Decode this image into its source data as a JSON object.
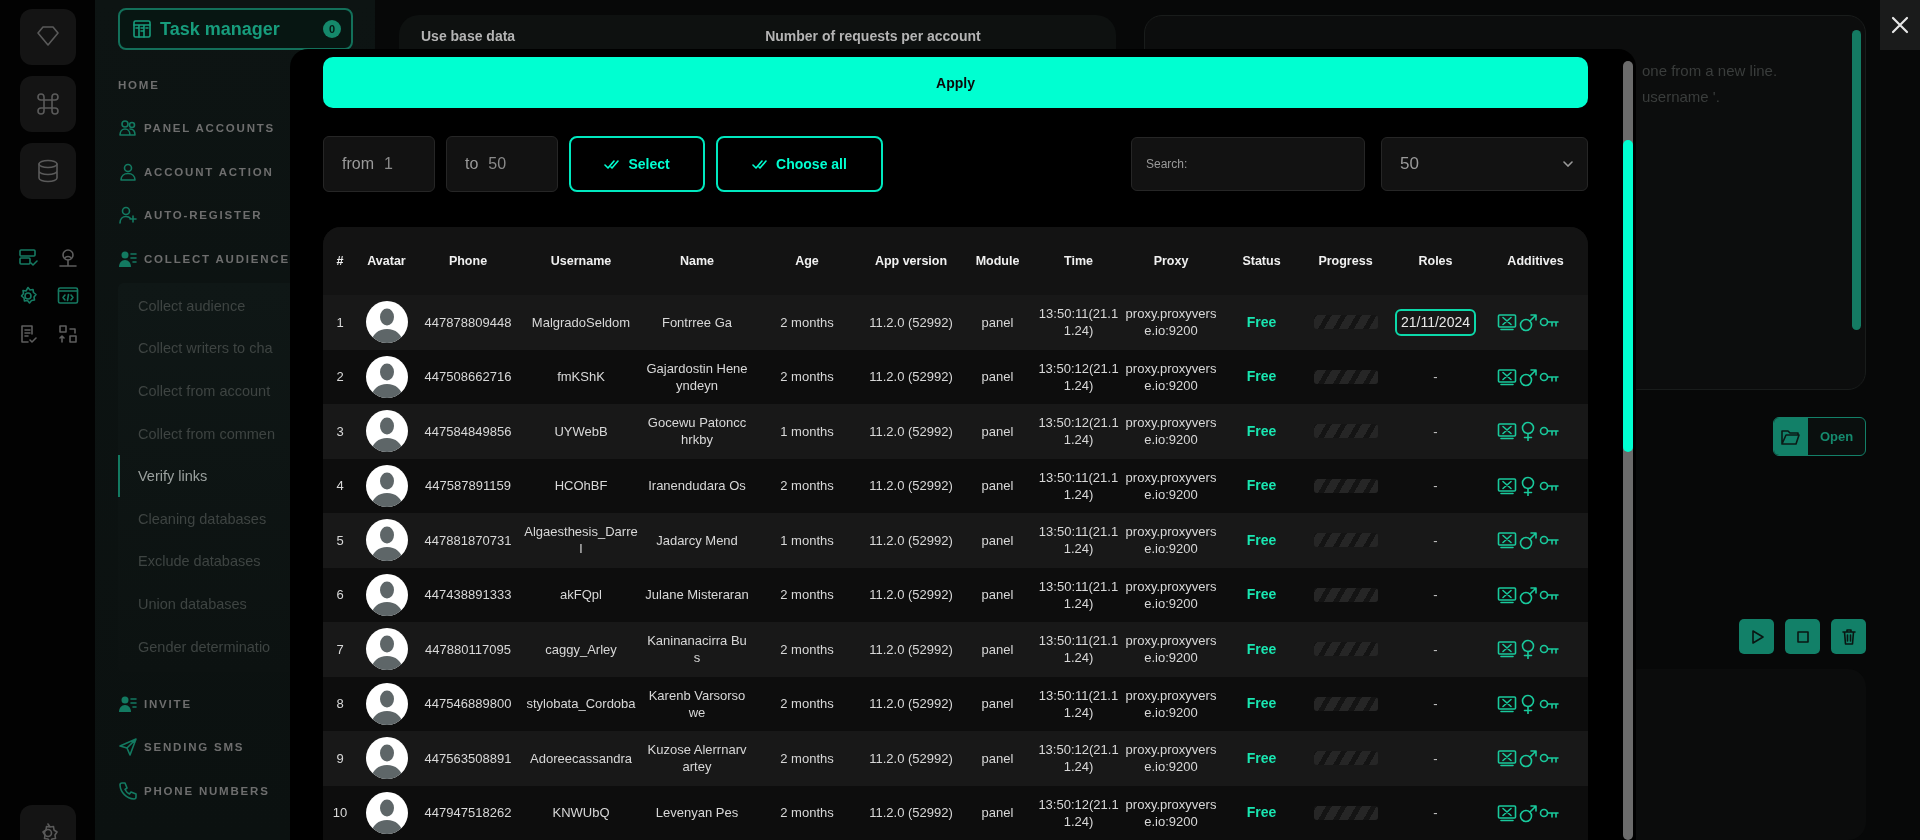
{
  "sidebar": {
    "task_manager": {
      "label": "Task manager",
      "badge": "0"
    },
    "menu": [
      {
        "label": "HOME",
        "kind": "heading"
      },
      {
        "label": "PANEL ACCOUNTS",
        "kind": "section"
      },
      {
        "label": "ACCOUNT ACTION",
        "kind": "section"
      },
      {
        "label": "AUTO-REGISTER",
        "kind": "section"
      },
      {
        "label": "COLLECT AUDIENCE",
        "kind": "section",
        "children": [
          {
            "label": "Collect audience",
            "selected": false
          },
          {
            "label": "Collect writers to cha",
            "selected": false
          },
          {
            "label": "Collect from account",
            "selected": false
          },
          {
            "label": "Collect from commen",
            "selected": false
          },
          {
            "label": "Verify links",
            "selected": true
          },
          {
            "label": "Cleaning databases",
            "selected": false
          },
          {
            "label": "Exclude databases",
            "selected": false
          },
          {
            "label": "Union databases",
            "selected": false
          },
          {
            "label": "Gender determinatio",
            "selected": false
          }
        ]
      },
      {
        "label": "INVITE",
        "kind": "section"
      },
      {
        "label": "SENDING SMS",
        "kind": "section"
      },
      {
        "label": "PHONE NUMBERS",
        "kind": "section"
      }
    ]
  },
  "settings_card": {
    "labels": [
      "Use base data",
      "Number of requests per account"
    ]
  },
  "list_card": {
    "placeholder_lines": [
      "one from a new line.",
      "username '."
    ]
  },
  "open_button": "Open",
  "modal": {
    "apply_button": "Apply",
    "from_field": {
      "label": "from",
      "value": "1"
    },
    "to_field": {
      "label": "to",
      "value": "50"
    },
    "select_button": "Select",
    "choose_all_button": "Choose all",
    "search": {
      "placeholder": "Search:"
    },
    "page_size": "50",
    "table": {
      "columns": [
        "#",
        "Avatar",
        "Phone",
        "Username",
        "Name",
        "Age",
        "App version",
        "Module",
        "Time",
        "Proxy",
        "Status",
        "Progress",
        "Roles",
        "Additives"
      ],
      "rows": [
        {
          "index": "1",
          "phone": "447878809448",
          "username": "MalgradoSeldom",
          "name": "Fontrree Ga",
          "age": "2 months",
          "app_version": "11.2.0 (52992)",
          "module": "panel",
          "time": "13:50:11(21.11.24)",
          "proxy": "proxy.proxyverse.io:9200",
          "status": "Free",
          "roles": {
            "kind": "badge",
            "text": "21/11/2024"
          },
          "kind": "male"
        },
        {
          "index": "2",
          "phone": "447508662716",
          "username": "fmKShK",
          "name": "Gajardostin Heneyndeyn",
          "age": "2 months",
          "app_version": "11.2.0 (52992)",
          "module": "panel",
          "time": "13:50:12(21.11.24)",
          "proxy": "proxy.proxyverse.io:9200",
          "status": "Free",
          "roles": {
            "kind": "plain",
            "text": "-"
          },
          "kind": "male"
        },
        {
          "index": "3",
          "phone": "447584849856",
          "username": "UYWebB",
          "name": "Gocewu Patoncchrkby",
          "age": "1 months",
          "app_version": "11.2.0 (52992)",
          "module": "panel",
          "time": "13:50:12(21.11.24)",
          "proxy": "proxy.proxyverse.io:9200",
          "status": "Free",
          "roles": {
            "kind": "plain",
            "text": "-"
          },
          "kind": "female"
        },
        {
          "index": "4",
          "phone": "447587891159",
          "username": "HCOhBF",
          "name": "Iranendudara Os",
          "age": "2 months",
          "app_version": "11.2.0 (52992)",
          "module": "panel",
          "time": "13:50:11(21.11.24)",
          "proxy": "proxy.proxyverse.io:9200",
          "status": "Free",
          "roles": {
            "kind": "plain",
            "text": "-"
          },
          "kind": "female"
        },
        {
          "index": "5",
          "phone": "447881870731",
          "username": "Algaesthesis_Darrel",
          "name": "Jadarcy Mend",
          "age": "1 months",
          "app_version": "11.2.0 (52992)",
          "module": "panel",
          "time": "13:50:11(21.11.24)",
          "proxy": "proxy.proxyverse.io:9200",
          "status": "Free",
          "roles": {
            "kind": "plain",
            "text": "-"
          },
          "kind": "male"
        },
        {
          "index": "6",
          "phone": "447438891333",
          "username": "akFQpl",
          "name": "Julane Misteraran",
          "age": "2 months",
          "app_version": "11.2.0 (52992)",
          "module": "panel",
          "time": "13:50:11(21.11.24)",
          "proxy": "proxy.proxyverse.io:9200",
          "status": "Free",
          "roles": {
            "kind": "plain",
            "text": "-"
          },
          "kind": "male"
        },
        {
          "index": "7",
          "phone": "447880117095",
          "username": "caggy_Arley",
          "name": "Kaninanacirra Bus",
          "age": "2 months",
          "app_version": "11.2.0 (52992)",
          "module": "panel",
          "time": "13:50:11(21.11.24)",
          "proxy": "proxy.proxyverse.io:9200",
          "status": "Free",
          "roles": {
            "kind": "plain",
            "text": "-"
          },
          "kind": "female"
        },
        {
          "index": "8",
          "phone": "447546889800",
          "username": "stylobata_Cordoba",
          "name": "Karenb Varsorsowe",
          "age": "2 months",
          "app_version": "11.2.0 (52992)",
          "module": "panel",
          "time": "13:50:11(21.11.24)",
          "proxy": "proxy.proxyverse.io:9200",
          "status": "Free",
          "roles": {
            "kind": "plain",
            "text": "-"
          },
          "kind": "female"
        },
        {
          "index": "9",
          "phone": "447563508891",
          "username": "Adoreecassandra",
          "name": "Kuzose Alerrnarvartey",
          "age": "2 months",
          "app_version": "11.2.0 (52992)",
          "module": "panel",
          "time": "13:50:12(21.11.24)",
          "proxy": "proxy.proxyverse.io:9200",
          "status": "Free",
          "roles": {
            "kind": "plain",
            "text": "-"
          },
          "kind": "male"
        },
        {
          "index": "10",
          "phone": "447947518262",
          "username": "KNWUbQ",
          "name": "Levenyan Pes",
          "age": "2 months",
          "app_version": "11.2.0 (52992)",
          "module": "panel",
          "time": "13:50:12(21.11.24)",
          "proxy": "proxy.proxyverse.io:9200",
          "status": "Free",
          "roles": {
            "kind": "plain",
            "text": "-"
          },
          "kind": "male"
        }
      ]
    }
  }
}
